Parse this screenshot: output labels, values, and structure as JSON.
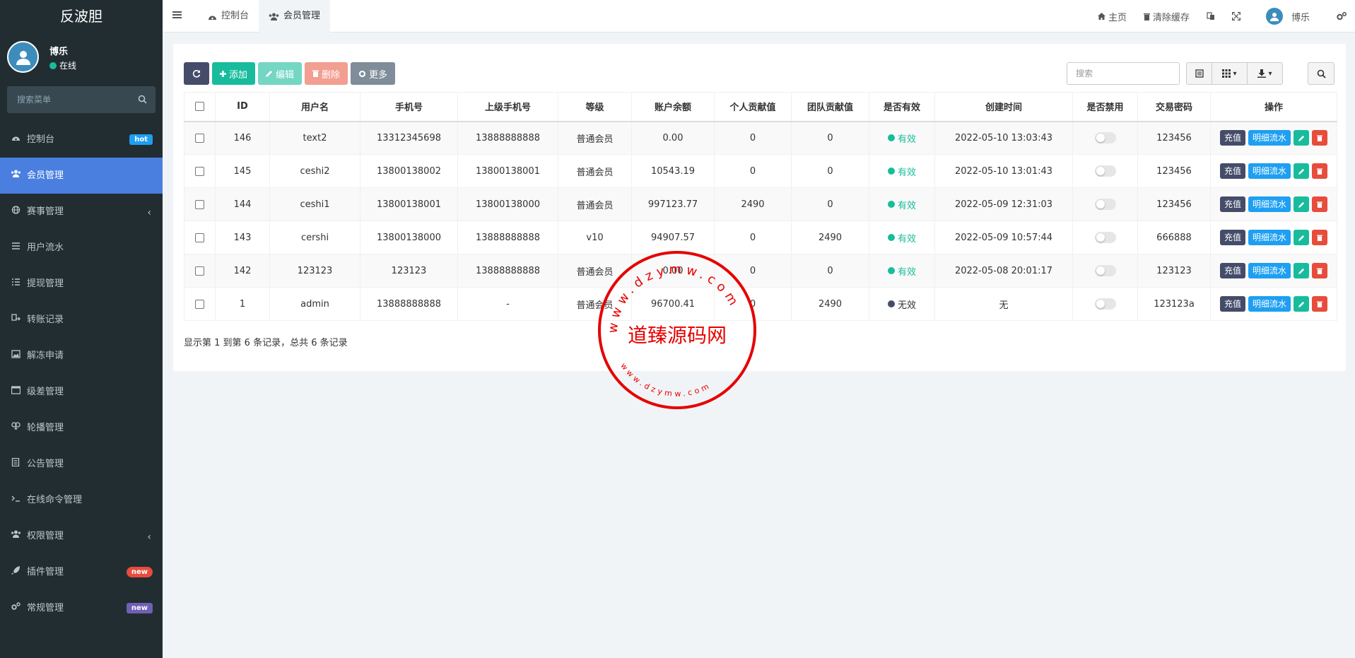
{
  "sidebar": {
    "logo": "反波胆",
    "user_name": "博乐",
    "user_status": "在线",
    "search_placeholder": "搜索菜单",
    "items": [
      {
        "label": "控制台",
        "icon": "dashboard-icon",
        "badge": "hot",
        "badge_color": "#1e9ff2"
      },
      {
        "label": "会员管理",
        "icon": "users-icon",
        "active": true
      },
      {
        "label": "赛事管理",
        "icon": "globe-icon",
        "arrow": "‹"
      },
      {
        "label": "用户流水",
        "icon": "list-icon"
      },
      {
        "label": "提现管理",
        "icon": "list-alt-icon"
      },
      {
        "label": "转账记录",
        "icon": "transfer-icon"
      },
      {
        "label": "解冻申请",
        "icon": "picture-icon"
      },
      {
        "label": "级差管理",
        "icon": "window-icon"
      },
      {
        "label": "轮播管理",
        "icon": "carousel-icon"
      },
      {
        "label": "公告管理",
        "icon": "file-icon"
      },
      {
        "label": "在线命令管理",
        "icon": "terminal-icon"
      },
      {
        "label": "权限管理",
        "icon": "group-icon",
        "arrow": "‹"
      },
      {
        "label": "插件管理",
        "icon": "rocket-icon",
        "badge": "new",
        "badge_color": "#e74c3c"
      },
      {
        "label": "常规管理",
        "icon": "cogs-icon",
        "badge": "new",
        "badge_color": "#6f5fb5"
      }
    ]
  },
  "topbar": {
    "tabs": [
      {
        "label": "控制台",
        "icon": "dashboard-icon"
      },
      {
        "label": "会员管理",
        "icon": "users-icon",
        "active": true
      }
    ],
    "home": "主页",
    "clear_cache": "清除缓存",
    "user_name": "博乐"
  },
  "toolbar": {
    "add": "添加",
    "edit": "编辑",
    "delete": "删除",
    "more": "更多",
    "search_placeholder": "搜索"
  },
  "table": {
    "columns": [
      "ID",
      "用户名",
      "手机号",
      "上级手机号",
      "等级",
      "账户余额",
      "个人贡献值",
      "团队贡献值",
      "是否有效",
      "创建时间",
      "是否禁用",
      "交易密码",
      "操作"
    ],
    "rows": [
      {
        "id": "146",
        "username": "text2",
        "phone": "13312345698",
        "parent_phone": "13888888888",
        "level": "普通会员",
        "balance": "0.00",
        "personal": "0",
        "team": "0",
        "valid": "有效",
        "valid_color": "#18bc9c",
        "created": "2022-05-10 13:03:43",
        "trade_pwd": "123456"
      },
      {
        "id": "145",
        "username": "ceshi2",
        "phone": "13800138002",
        "parent_phone": "13800138001",
        "level": "普通会员",
        "balance": "10543.19",
        "personal": "0",
        "team": "0",
        "valid": "有效",
        "valid_color": "#18bc9c",
        "created": "2022-05-10 13:01:43",
        "trade_pwd": "123456"
      },
      {
        "id": "144",
        "username": "ceshi1",
        "phone": "13800138001",
        "parent_phone": "13800138000",
        "level": "普通会员",
        "balance": "997123.77",
        "personal": "2490",
        "team": "0",
        "valid": "有效",
        "valid_color": "#18bc9c",
        "created": "2022-05-09 12:31:03",
        "trade_pwd": "123456"
      },
      {
        "id": "143",
        "username": "cershi",
        "phone": "13800138000",
        "parent_phone": "13888888888",
        "level": "v10",
        "balance": "94907.57",
        "personal": "0",
        "team": "2490",
        "valid": "有效",
        "valid_color": "#18bc9c",
        "created": "2022-05-09 10:57:44",
        "trade_pwd": "666888"
      },
      {
        "id": "142",
        "username": "123123",
        "phone": "123123",
        "parent_phone": "13888888888",
        "level": "普通会员",
        "balance": "0.00",
        "personal": "0",
        "team": "0",
        "valid": "有效",
        "valid_color": "#18bc9c",
        "created": "2022-05-08 20:01:17",
        "trade_pwd": "123123"
      },
      {
        "id": "1",
        "username": "admin",
        "phone": "13888888888",
        "parent_phone": "-",
        "level": "普通会员",
        "balance": "96700.41",
        "personal": "0",
        "team": "2490",
        "valid": "无效",
        "valid_color": "#444c69",
        "created": "无",
        "trade_pwd": "123123a"
      }
    ],
    "ops": {
      "recharge": "充值",
      "detail": "明细流水"
    }
  },
  "pagination_text": "显示第 1 到第 6 条记录，总共 6 条记录",
  "watermark": {
    "title": "道臻源码网",
    "ring_text": "www.dzymw.com"
  }
}
